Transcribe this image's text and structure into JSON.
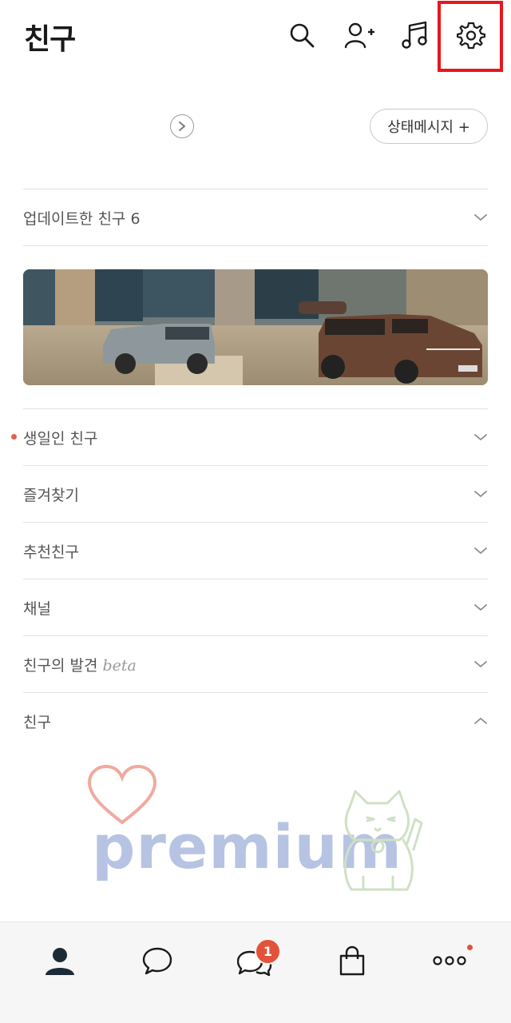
{
  "header": {
    "title": "친구",
    "icons": [
      "search-icon",
      "add-friend-icon",
      "music-icon",
      "settings-icon"
    ]
  },
  "status": {
    "button_label": "상태메시지 +"
  },
  "sections": {
    "updated_friends": "업데이트한 친구 6",
    "birthday_friends": "생일인 친구",
    "favorites": "즐겨찾기",
    "recommended": "추천친구",
    "channels": "채널",
    "friend_discovery": "친구의 발견",
    "friend_discovery_tag": "beta",
    "friends": "친구"
  },
  "watermark": {
    "text": "premium"
  },
  "bottom_nav": {
    "items": [
      "friends-tab",
      "chats-tab",
      "openchat-tab",
      "shopping-tab",
      "more-tab"
    ],
    "openchat_badge": "1"
  },
  "colors": {
    "accent": "#e2533a",
    "highlight": "#e8161c"
  }
}
